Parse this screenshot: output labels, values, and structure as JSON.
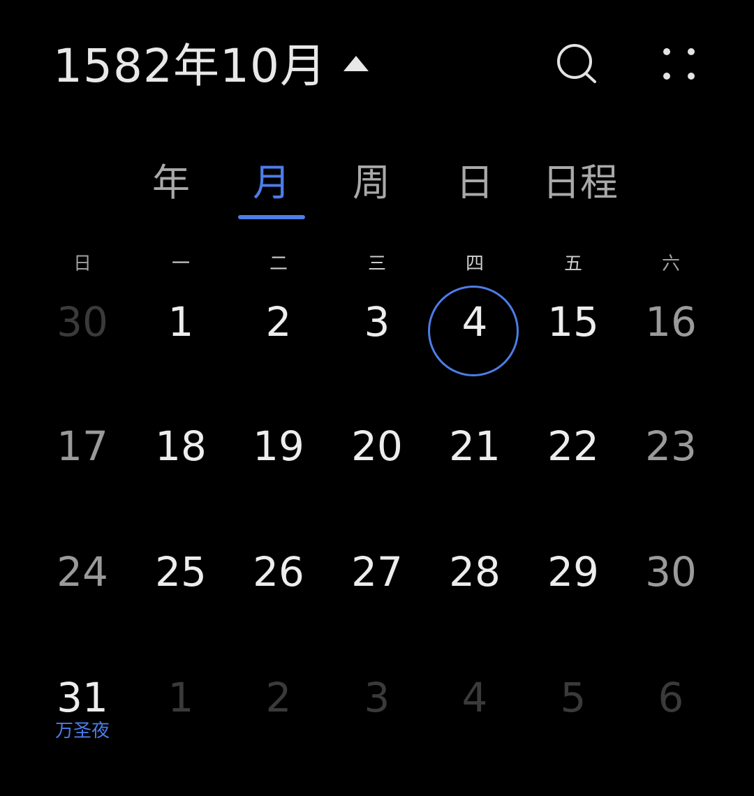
{
  "header": {
    "title": "1582年10月"
  },
  "tabs": [
    {
      "label": "年",
      "active": false
    },
    {
      "label": "月",
      "active": true
    },
    {
      "label": "周",
      "active": false
    },
    {
      "label": "日",
      "active": false
    },
    {
      "label": "日程",
      "active": false
    }
  ],
  "weekdays": [
    "日",
    "一",
    "二",
    "三",
    "四",
    "五",
    "六"
  ],
  "weeks": [
    [
      {
        "day": "30",
        "muted": true
      },
      {
        "day": "1"
      },
      {
        "day": "2"
      },
      {
        "day": "3"
      },
      {
        "day": "4",
        "today": true
      },
      {
        "day": "15"
      },
      {
        "day": "16"
      }
    ],
    [
      {
        "day": "17"
      },
      {
        "day": "18"
      },
      {
        "day": "19"
      },
      {
        "day": "20"
      },
      {
        "day": "21"
      },
      {
        "day": "22"
      },
      {
        "day": "23"
      }
    ],
    [
      {
        "day": "24"
      },
      {
        "day": "25"
      },
      {
        "day": "26"
      },
      {
        "day": "27"
      },
      {
        "day": "28"
      },
      {
        "day": "29"
      },
      {
        "day": "30"
      }
    ],
    [
      {
        "day": "31",
        "festival": "万圣夜"
      },
      {
        "day": "1",
        "muted": true
      },
      {
        "day": "2",
        "muted": true
      },
      {
        "day": "3",
        "muted": true
      },
      {
        "day": "4",
        "muted": true
      },
      {
        "day": "5",
        "muted": true
      },
      {
        "day": "6",
        "muted": true
      }
    ]
  ],
  "colors": {
    "accent": "#4d7de8",
    "background": "#000000"
  },
  "icons": {
    "search": "search-icon",
    "more": "more-grid-icon",
    "expand": "caret-up-icon"
  }
}
